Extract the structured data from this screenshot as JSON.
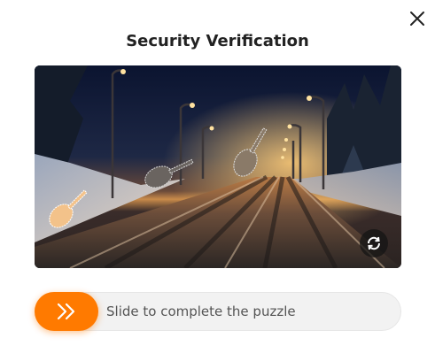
{
  "dialog": {
    "title": "Security Verification",
    "close_icon": "close-icon"
  },
  "puzzle": {
    "image_icon": "snowy-road-night-image",
    "refresh_icon": "refresh-icon"
  },
  "slider": {
    "handle_icon": "double-chevron-right-icon",
    "label": "Slide to complete the puzzle",
    "accent": "#ff7a00"
  }
}
